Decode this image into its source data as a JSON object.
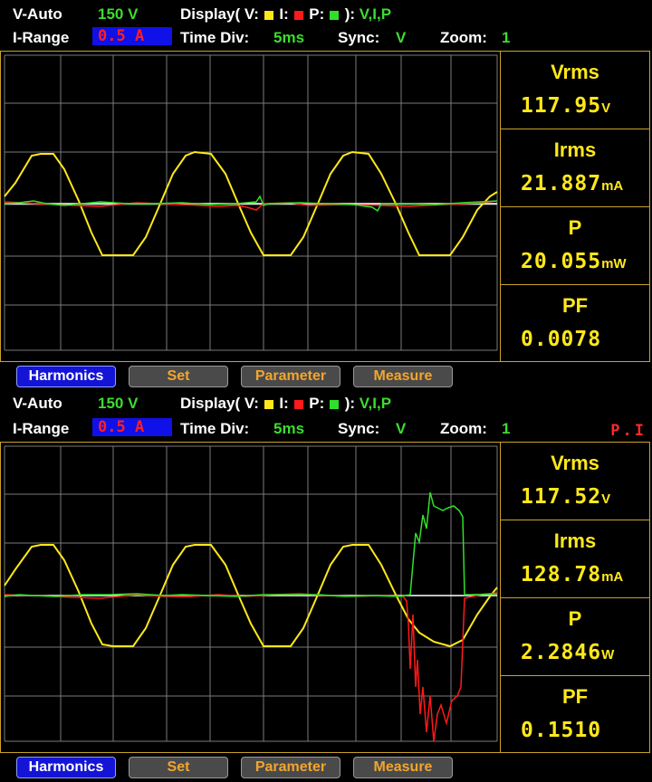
{
  "colors": {
    "voltage": "#ffe81a",
    "current": "#ff1a1a",
    "power": "#2fe02a",
    "accent": "#c9a227"
  },
  "panels": [
    {
      "v_range_label": "V-Auto",
      "v_range_value": "150 V",
      "display_label": "Display( V:",
      "i_sep": " I:",
      "p_sep": " P:",
      "display_close": " ):",
      "display_value": "V,I,P",
      "i_range_label": "I-Range",
      "i_range_value": "0.5 A",
      "time_label": "Time  Div:",
      "time_value": "5ms",
      "sync_label": "Sync:",
      "sync_value": "V",
      "zoom_label": "Zoom:",
      "zoom_value": "1",
      "indicator": "",
      "readouts": [
        {
          "label": "Vrms",
          "value": "117.95",
          "unit": "V"
        },
        {
          "label": "Irms",
          "value": "21.887",
          "unit": "mA"
        },
        {
          "label": "P",
          "value": "20.055",
          "unit": "mW"
        },
        {
          "label": "PF",
          "value": "0.0078",
          "unit": ""
        }
      ],
      "buttons": [
        "Harmonics",
        "Set",
        "Parameter",
        "Measure"
      ]
    },
    {
      "v_range_label": "V-Auto",
      "v_range_value": "150 V",
      "display_label": "Display( V:",
      "i_sep": " I:",
      "p_sep": " P:",
      "display_close": " ):",
      "display_value": "V,I,P",
      "i_range_label": "I-Range",
      "i_range_value": "0.5 A",
      "time_label": "Time  Div:",
      "time_value": "5ms",
      "sync_label": "Sync:",
      "sync_value": "V",
      "zoom_label": "Zoom:",
      "zoom_value": "1",
      "indicator": "P.I",
      "readouts": [
        {
          "label": "Vrms",
          "value": "117.52",
          "unit": "V"
        },
        {
          "label": "Irms",
          "value": "128.78",
          "unit": "mA"
        },
        {
          "label": "P",
          "value": "2.2846",
          "unit": "W"
        },
        {
          "label": "PF",
          "value": "0.1510",
          "unit": ""
        }
      ],
      "buttons": [
        "Harmonics",
        "Set",
        "Parameter",
        "Measure"
      ]
    }
  ]
}
